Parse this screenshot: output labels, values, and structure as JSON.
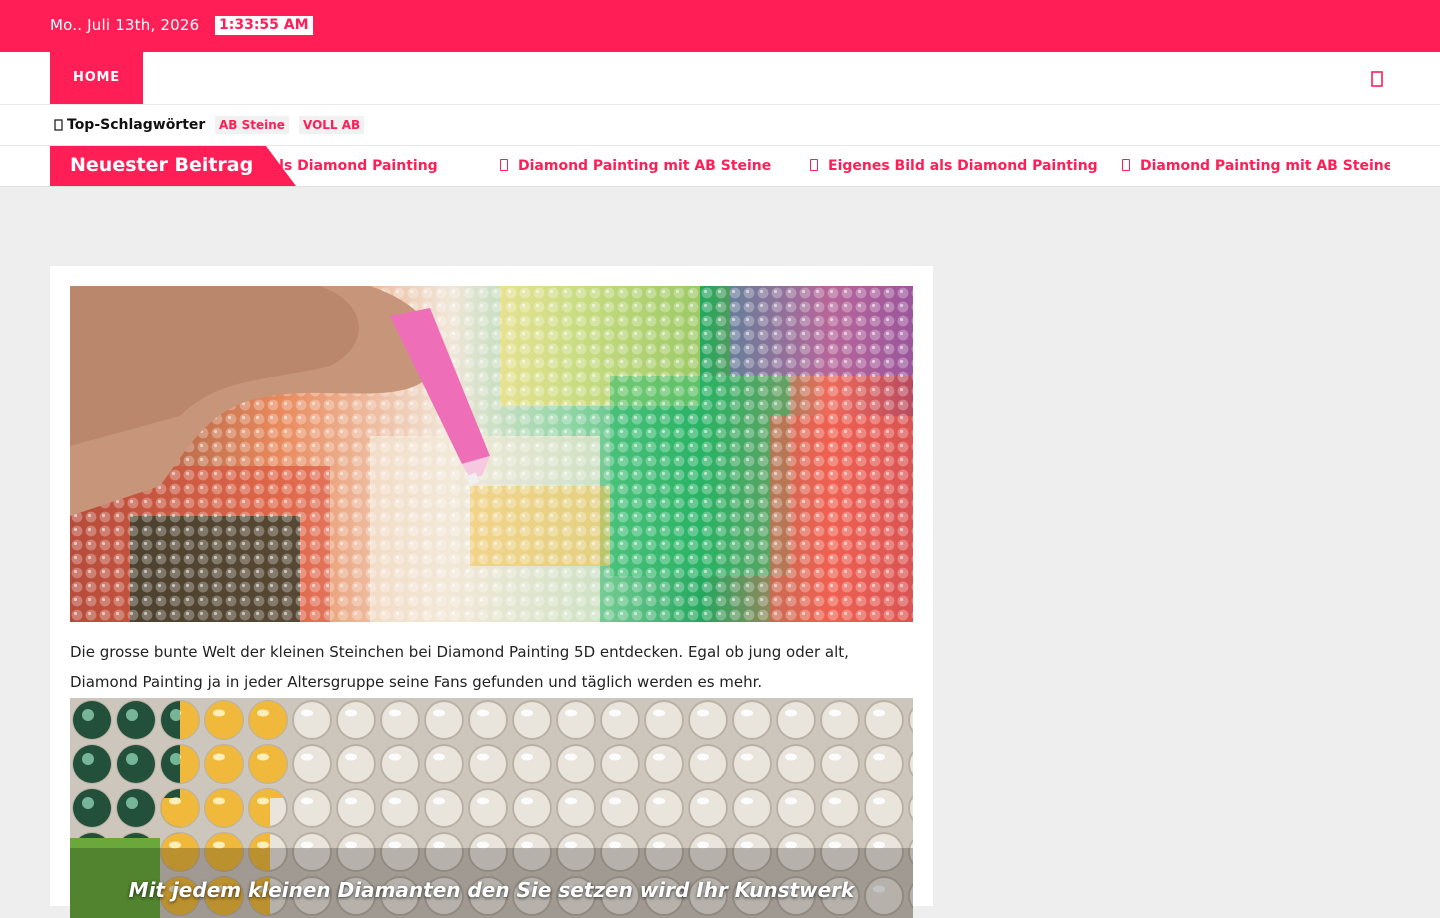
{
  "topbar": {
    "date": "Mo.. Juli 13th, 2026",
    "time": "1:33:55 AM"
  },
  "nav": {
    "home_label": "HOME",
    "search_icon": "search-icon"
  },
  "tags": {
    "title": "Top-Schlagwörter",
    "icon": "tag-icon",
    "chips": [
      "AB Steine",
      "VOLL AB"
    ]
  },
  "ticker": {
    "label": "Neuester Beitrag",
    "items": [
      "Eigenes Bild als Diamond Painting",
      "Diamond Painting mit AB Steine",
      "Eigenes Bild als Diamond Painting",
      "Diamond Painting mit AB Steine"
    ]
  },
  "post": {
    "paragraph": "Die grosse bunte Welt der kleinen Steinchen bei Diamond Painting 5D entdecken. Egal ob jung oder alt, Diamond Painting ja in jeder Altersgruppe seine Fans gefunden und täglich werden es mehr.",
    "image_caption": "Mit jedem kleinen Diamanten den Sie setzen wird Ihr Kunstwerk"
  },
  "colors": {
    "accent": "#ff1e56",
    "background": "#eeeeee"
  }
}
